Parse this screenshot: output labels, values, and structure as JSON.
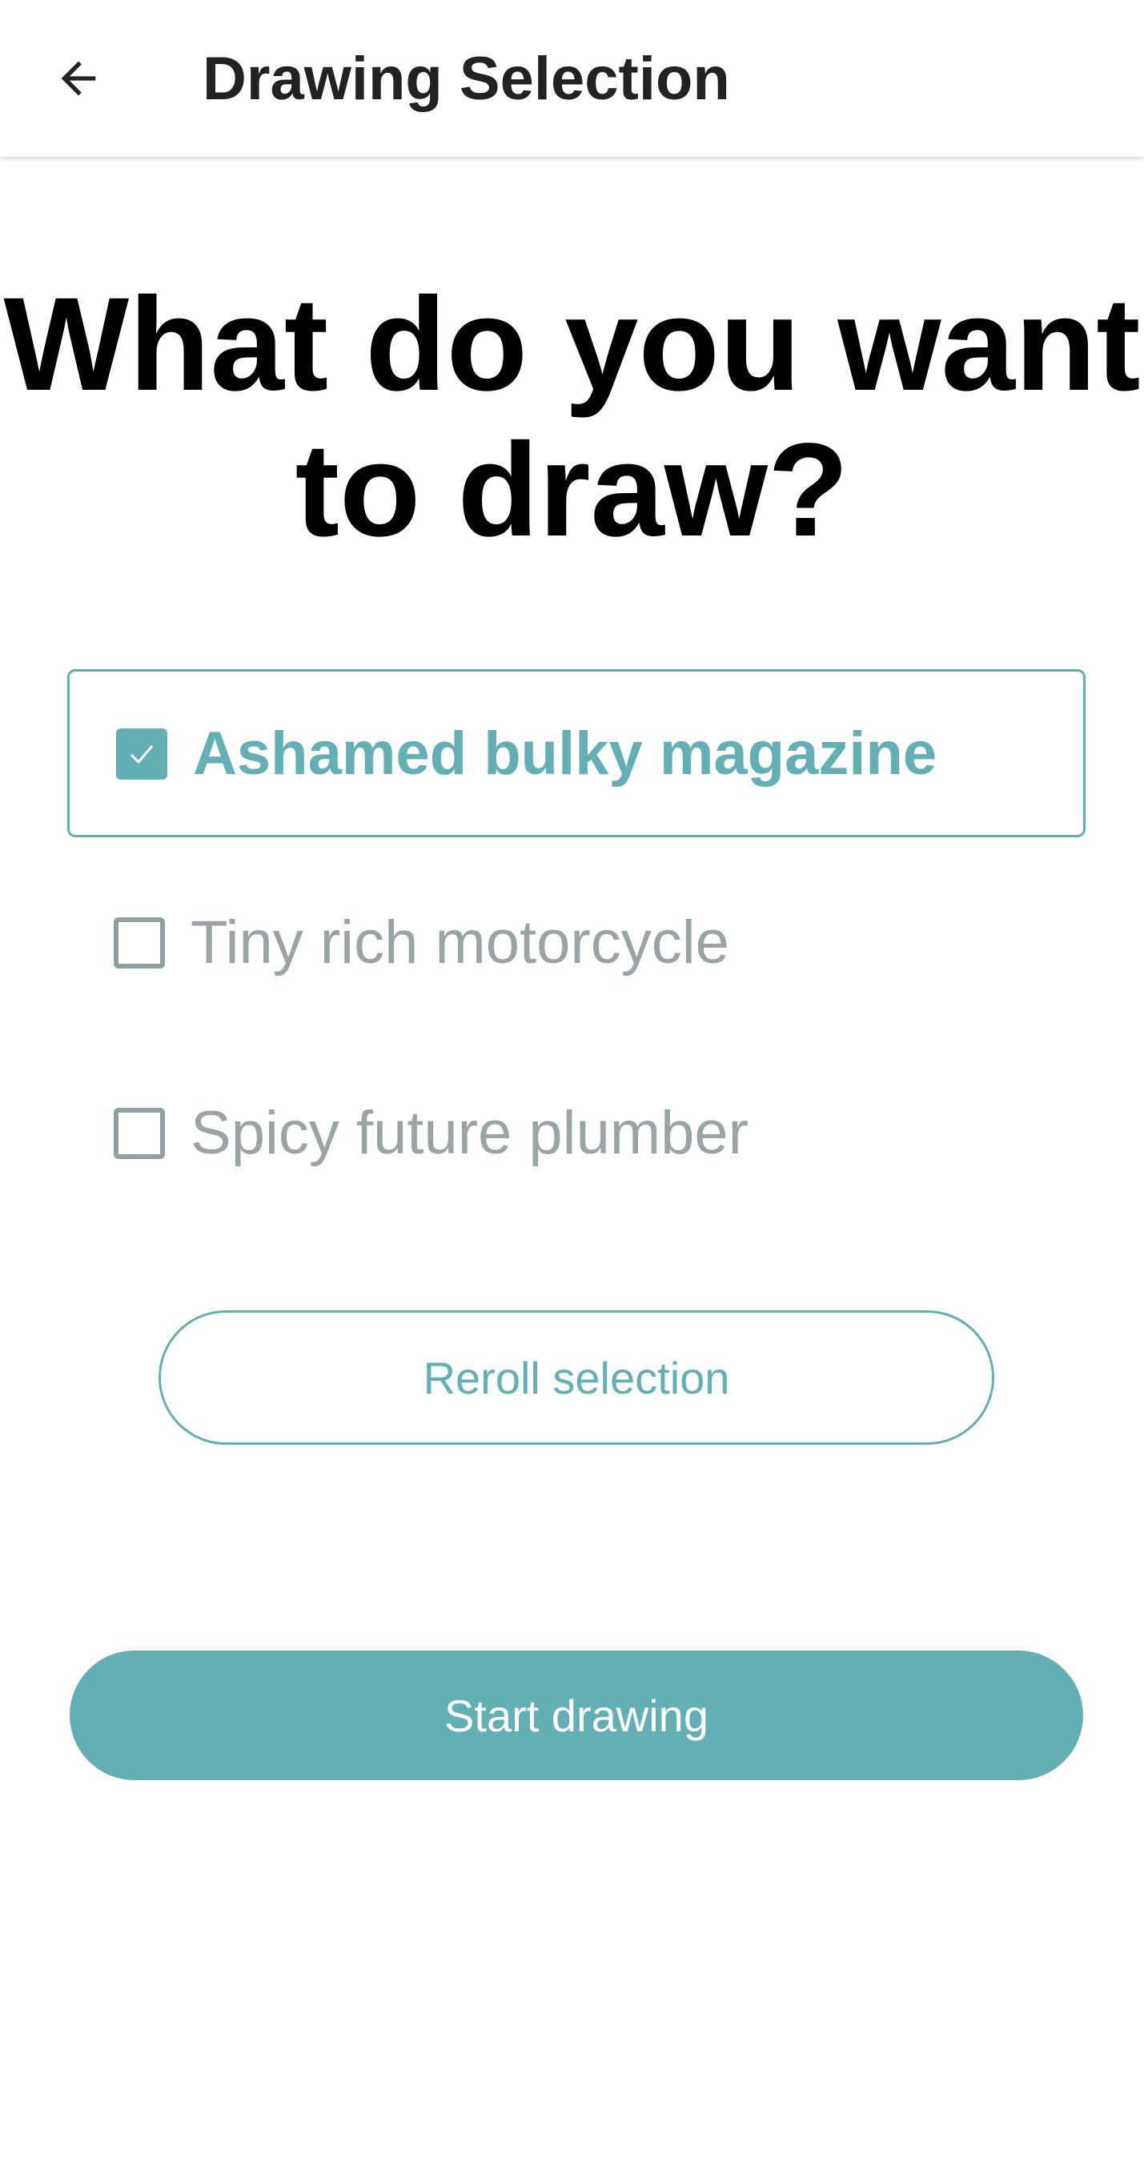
{
  "app_bar": {
    "back_icon": "arrow-left-icon",
    "title": "Drawing Selection"
  },
  "headline": {
    "line1": "What do you want",
    "line2": "to draw?"
  },
  "options": [
    {
      "label": "Ashamed bulky magazine",
      "checked": true,
      "check_icon": "checkmark-icon"
    },
    {
      "label": "Tiny rich motorcycle",
      "checked": false
    },
    {
      "label": "Spicy future plumber",
      "checked": false
    }
  ],
  "reroll_button": {
    "label": "Reroll selection"
  },
  "start_button": {
    "label": "Start drawing"
  },
  "colors": {
    "accent": "#62b0b4",
    "muted_text": "#9aa4a6",
    "title_text": "#222222"
  }
}
